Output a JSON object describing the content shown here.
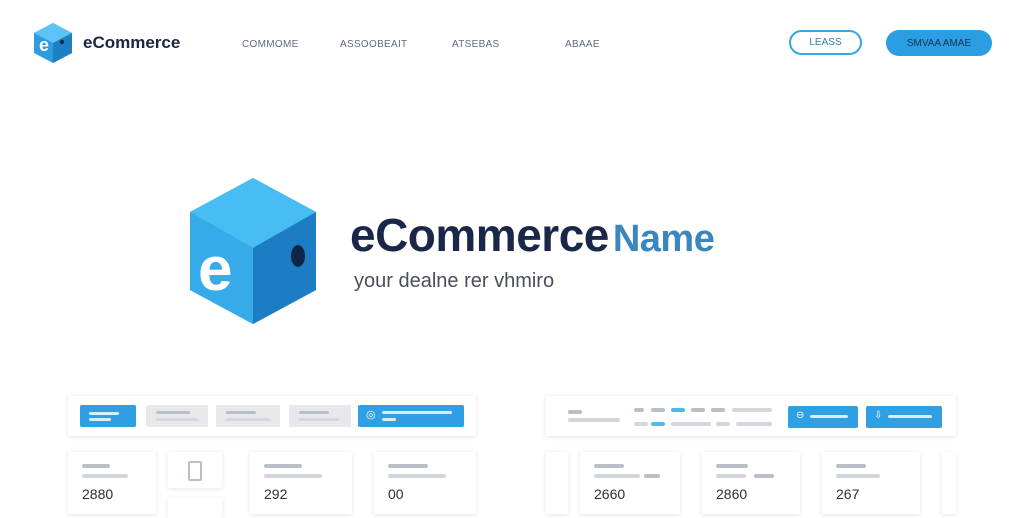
{
  "header": {
    "brand": "eCommerce",
    "nav": [
      "COMMOME",
      "ASSOOBEAIT",
      "ATSEBAS",
      "ABAAE"
    ],
    "login_label": "LEASS",
    "signup_label": "SMVAA AMAE"
  },
  "hero": {
    "title": "eCommerce",
    "title_accent": "Name",
    "subtitle": "your dealne rer vhmiro"
  },
  "dashboard_left": {
    "stats": [
      "2880",
      "292",
      "00"
    ]
  },
  "dashboard_right": {
    "stats": [
      "2660",
      "2860",
      "267"
    ]
  },
  "colors": {
    "accent": "#2b9de3",
    "brand_dark": "#1a2748",
    "brand_accent": "#3a86bf"
  }
}
